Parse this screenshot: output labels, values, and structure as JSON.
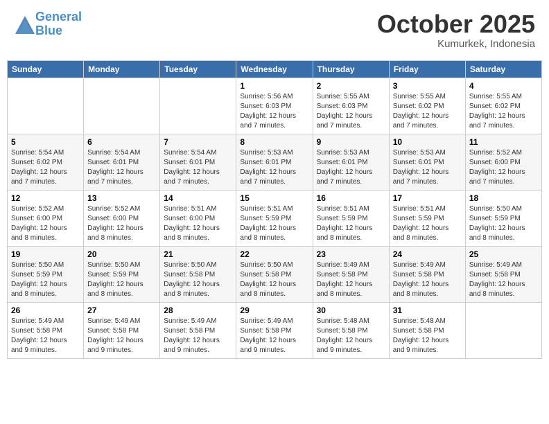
{
  "header": {
    "logo_line1": "General",
    "logo_line2": "Blue",
    "month": "October 2025",
    "location": "Kumurkek, Indonesia"
  },
  "weekdays": [
    "Sunday",
    "Monday",
    "Tuesday",
    "Wednesday",
    "Thursday",
    "Friday",
    "Saturday"
  ],
  "weeks": [
    [
      {
        "day": "",
        "info": ""
      },
      {
        "day": "",
        "info": ""
      },
      {
        "day": "",
        "info": ""
      },
      {
        "day": "1",
        "info": "Sunrise: 5:56 AM\nSunset: 6:03 PM\nDaylight: 12 hours\nand 7 minutes."
      },
      {
        "day": "2",
        "info": "Sunrise: 5:55 AM\nSunset: 6:03 PM\nDaylight: 12 hours\nand 7 minutes."
      },
      {
        "day": "3",
        "info": "Sunrise: 5:55 AM\nSunset: 6:02 PM\nDaylight: 12 hours\nand 7 minutes."
      },
      {
        "day": "4",
        "info": "Sunrise: 5:55 AM\nSunset: 6:02 PM\nDaylight: 12 hours\nand 7 minutes."
      }
    ],
    [
      {
        "day": "5",
        "info": "Sunrise: 5:54 AM\nSunset: 6:02 PM\nDaylight: 12 hours\nand 7 minutes."
      },
      {
        "day": "6",
        "info": "Sunrise: 5:54 AM\nSunset: 6:01 PM\nDaylight: 12 hours\nand 7 minutes."
      },
      {
        "day": "7",
        "info": "Sunrise: 5:54 AM\nSunset: 6:01 PM\nDaylight: 12 hours\nand 7 minutes."
      },
      {
        "day": "8",
        "info": "Sunrise: 5:53 AM\nSunset: 6:01 PM\nDaylight: 12 hours\nand 7 minutes."
      },
      {
        "day": "9",
        "info": "Sunrise: 5:53 AM\nSunset: 6:01 PM\nDaylight: 12 hours\nand 7 minutes."
      },
      {
        "day": "10",
        "info": "Sunrise: 5:53 AM\nSunset: 6:01 PM\nDaylight: 12 hours\nand 7 minutes."
      },
      {
        "day": "11",
        "info": "Sunrise: 5:52 AM\nSunset: 6:00 PM\nDaylight: 12 hours\nand 7 minutes."
      }
    ],
    [
      {
        "day": "12",
        "info": "Sunrise: 5:52 AM\nSunset: 6:00 PM\nDaylight: 12 hours\nand 8 minutes."
      },
      {
        "day": "13",
        "info": "Sunrise: 5:52 AM\nSunset: 6:00 PM\nDaylight: 12 hours\nand 8 minutes."
      },
      {
        "day": "14",
        "info": "Sunrise: 5:51 AM\nSunset: 6:00 PM\nDaylight: 12 hours\nand 8 minutes."
      },
      {
        "day": "15",
        "info": "Sunrise: 5:51 AM\nSunset: 5:59 PM\nDaylight: 12 hours\nand 8 minutes."
      },
      {
        "day": "16",
        "info": "Sunrise: 5:51 AM\nSunset: 5:59 PM\nDaylight: 12 hours\nand 8 minutes."
      },
      {
        "day": "17",
        "info": "Sunrise: 5:51 AM\nSunset: 5:59 PM\nDaylight: 12 hours\nand 8 minutes."
      },
      {
        "day": "18",
        "info": "Sunrise: 5:50 AM\nSunset: 5:59 PM\nDaylight: 12 hours\nand 8 minutes."
      }
    ],
    [
      {
        "day": "19",
        "info": "Sunrise: 5:50 AM\nSunset: 5:59 PM\nDaylight: 12 hours\nand 8 minutes."
      },
      {
        "day": "20",
        "info": "Sunrise: 5:50 AM\nSunset: 5:59 PM\nDaylight: 12 hours\nand 8 minutes."
      },
      {
        "day": "21",
        "info": "Sunrise: 5:50 AM\nSunset: 5:58 PM\nDaylight: 12 hours\nand 8 minutes."
      },
      {
        "day": "22",
        "info": "Sunrise: 5:50 AM\nSunset: 5:58 PM\nDaylight: 12 hours\nand 8 minutes."
      },
      {
        "day": "23",
        "info": "Sunrise: 5:49 AM\nSunset: 5:58 PM\nDaylight: 12 hours\nand 8 minutes."
      },
      {
        "day": "24",
        "info": "Sunrise: 5:49 AM\nSunset: 5:58 PM\nDaylight: 12 hours\nand 8 minutes."
      },
      {
        "day": "25",
        "info": "Sunrise: 5:49 AM\nSunset: 5:58 PM\nDaylight: 12 hours\nand 8 minutes."
      }
    ],
    [
      {
        "day": "26",
        "info": "Sunrise: 5:49 AM\nSunset: 5:58 PM\nDaylight: 12 hours\nand 9 minutes."
      },
      {
        "day": "27",
        "info": "Sunrise: 5:49 AM\nSunset: 5:58 PM\nDaylight: 12 hours\nand 9 minutes."
      },
      {
        "day": "28",
        "info": "Sunrise: 5:49 AM\nSunset: 5:58 PM\nDaylight: 12 hours\nand 9 minutes."
      },
      {
        "day": "29",
        "info": "Sunrise: 5:49 AM\nSunset: 5:58 PM\nDaylight: 12 hours\nand 9 minutes."
      },
      {
        "day": "30",
        "info": "Sunrise: 5:48 AM\nSunset: 5:58 PM\nDaylight: 12 hours\nand 9 minutes."
      },
      {
        "day": "31",
        "info": "Sunrise: 5:48 AM\nSunset: 5:58 PM\nDaylight: 12 hours\nand 9 minutes."
      },
      {
        "day": "",
        "info": ""
      }
    ]
  ]
}
